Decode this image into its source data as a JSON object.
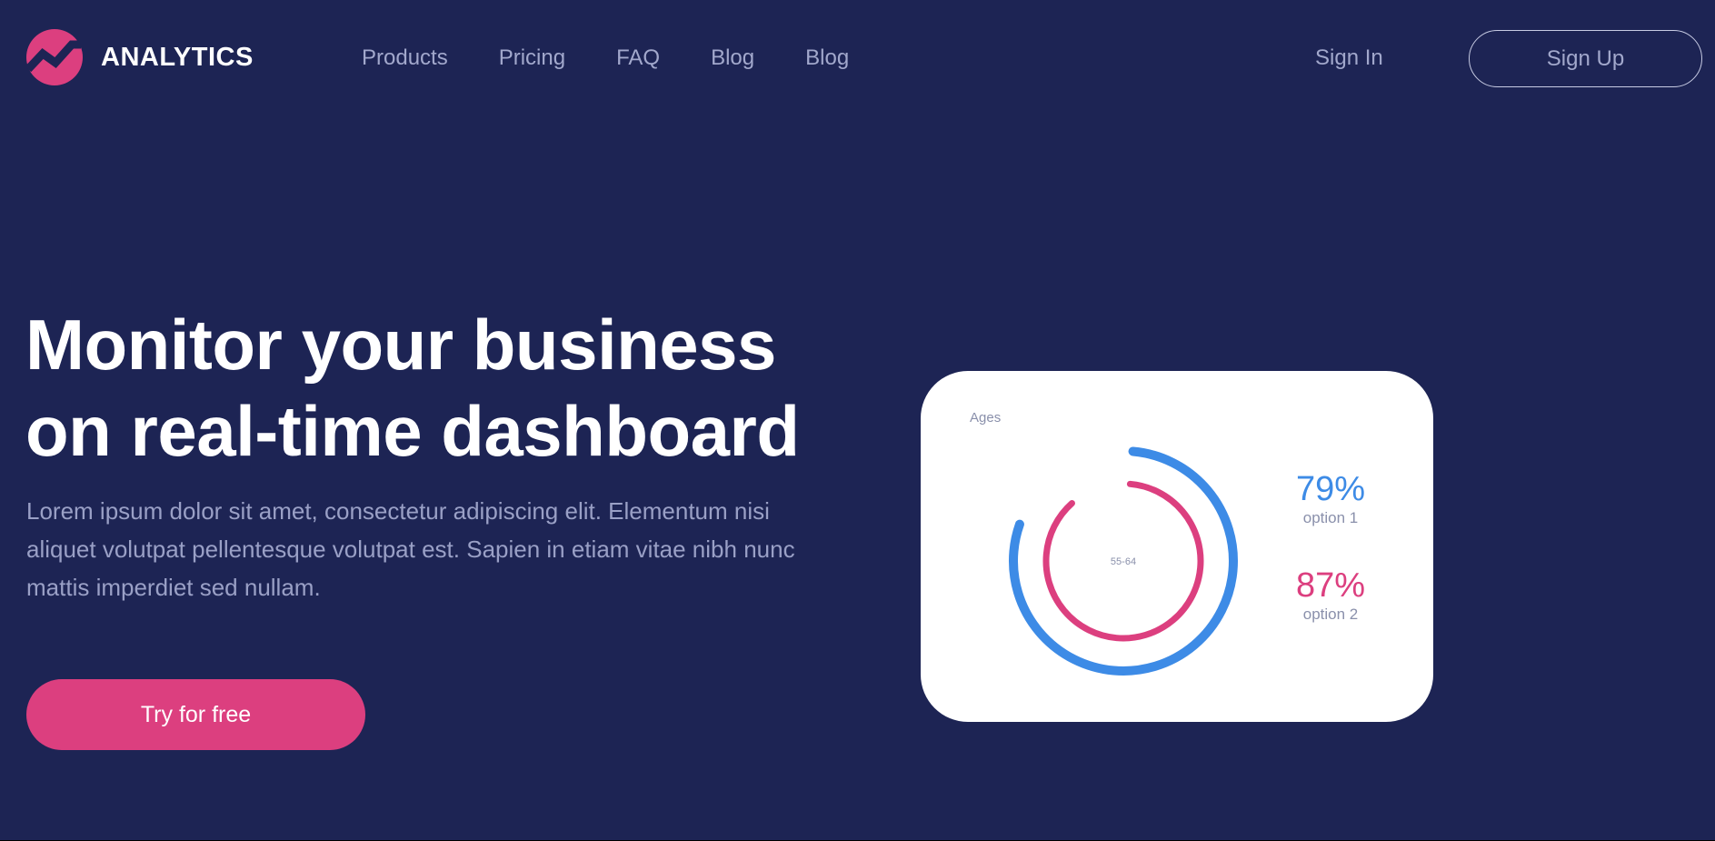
{
  "brand": {
    "name": "ANALYTICS",
    "accent": "#dc3f7f"
  },
  "nav": {
    "items": [
      {
        "label": "Products"
      },
      {
        "label": "Pricing"
      },
      {
        "label": "FAQ"
      },
      {
        "label": "Blog"
      },
      {
        "label": "Blog"
      }
    ]
  },
  "auth": {
    "signin_label": "Sign In",
    "signup_label": "Sign Up"
  },
  "hero": {
    "title_line1": "Monitor your business",
    "title_line2": "on real-time dashboard",
    "description": "Lorem ipsum dolor sit amet, consectetur adipiscing elit. Elementum nisi aliquet volutpat pellentesque volutpat est. Sapien in etiam vitae nibh nunc mattis imperdiet sed nullam.",
    "cta_label": "Try for free"
  },
  "dashboard": {
    "label": "Ages",
    "center_label": "55-64",
    "options": [
      {
        "value": "79%",
        "fraction": 0.79,
        "label": "option 1",
        "color": "#3d8be6"
      },
      {
        "value": "87%",
        "fraction": 0.87,
        "label": "option 2",
        "color": "#dc3f7f"
      }
    ]
  },
  "colors": {
    "background": "#1d2454",
    "nav_text": "#a2a8cc",
    "body_text": "#9aa0c6",
    "card": "#ffffff"
  }
}
